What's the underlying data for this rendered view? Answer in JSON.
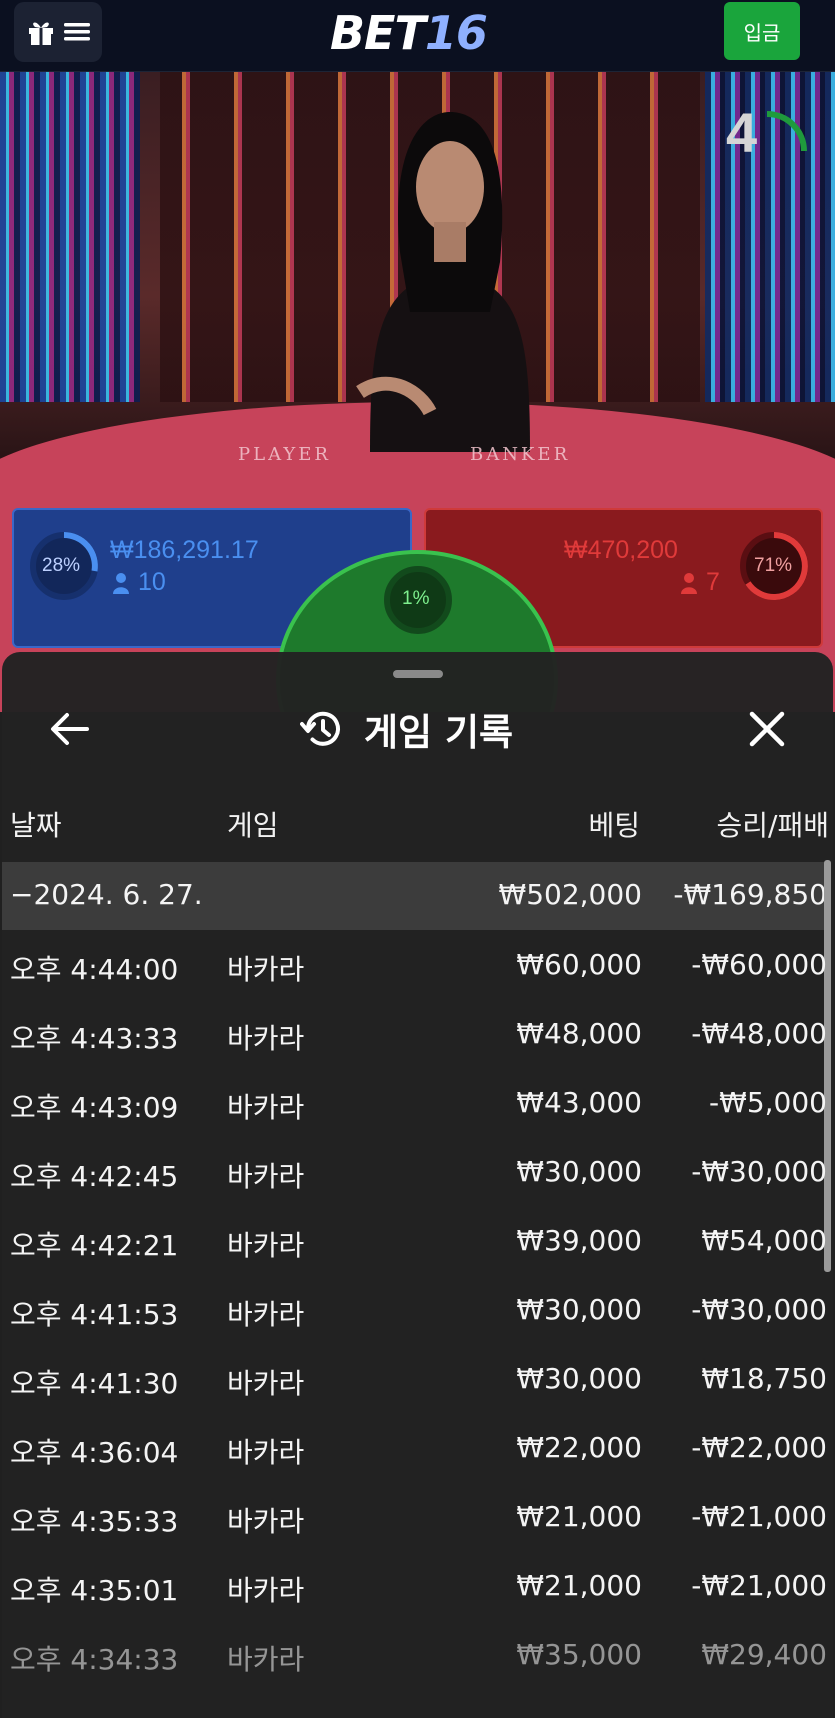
{
  "header": {
    "logo_main": "BET",
    "logo_num": "16",
    "deposit_label": "입금"
  },
  "stream": {
    "timer": "4",
    "player_label": "PLAYER",
    "banker_label": "BANKER",
    "player": {
      "percent": "28%",
      "amount": "₩186,291.17",
      "count": "10"
    },
    "banker": {
      "percent": "71%",
      "amount": "₩470,200",
      "count": "7"
    },
    "tie": {
      "percent": "1%"
    }
  },
  "history": {
    "title": "게임 기록",
    "columns": {
      "date": "날짜",
      "game": "게임",
      "bet": "베팅",
      "result": "승리/패배"
    },
    "summary": {
      "date": "−2024. 6. 27.",
      "bet": "₩502,000",
      "result": "-₩169,850"
    },
    "rows": [
      {
        "time": "오후 4:44:00",
        "game": "바카라",
        "bet": "₩60,000",
        "result": "-₩60,000"
      },
      {
        "time": "오후 4:43:33",
        "game": "바카라",
        "bet": "₩48,000",
        "result": "-₩48,000"
      },
      {
        "time": "오후 4:43:09",
        "game": "바카라",
        "bet": "₩43,000",
        "result": "-₩5,000"
      },
      {
        "time": "오후 4:42:45",
        "game": "바카라",
        "bet": "₩30,000",
        "result": "-₩30,000"
      },
      {
        "time": "오후 4:42:21",
        "game": "바카라",
        "bet": "₩39,000",
        "result": "₩54,000"
      },
      {
        "time": "오후 4:41:53",
        "game": "바카라",
        "bet": "₩30,000",
        "result": "-₩30,000"
      },
      {
        "time": "오후 4:41:30",
        "game": "바카라",
        "bet": "₩30,000",
        "result": "₩18,750"
      },
      {
        "time": "오후 4:36:04",
        "game": "바카라",
        "bet": "₩22,000",
        "result": "-₩22,000"
      },
      {
        "time": "오후 4:35:33",
        "game": "바카라",
        "bet": "₩21,000",
        "result": "-₩21,000"
      },
      {
        "time": "오후 4:35:01",
        "game": "바카라",
        "bet": "₩21,000",
        "result": "-₩21,000"
      },
      {
        "time": "오후 4:34:33",
        "game": "바카라",
        "bet": "₩35,000",
        "result": "₩29,400"
      }
    ]
  },
  "colors": {
    "accent_green": "#1aa53c",
    "player_blue": "#1f3f8c",
    "banker_red": "#8a1a1e"
  }
}
